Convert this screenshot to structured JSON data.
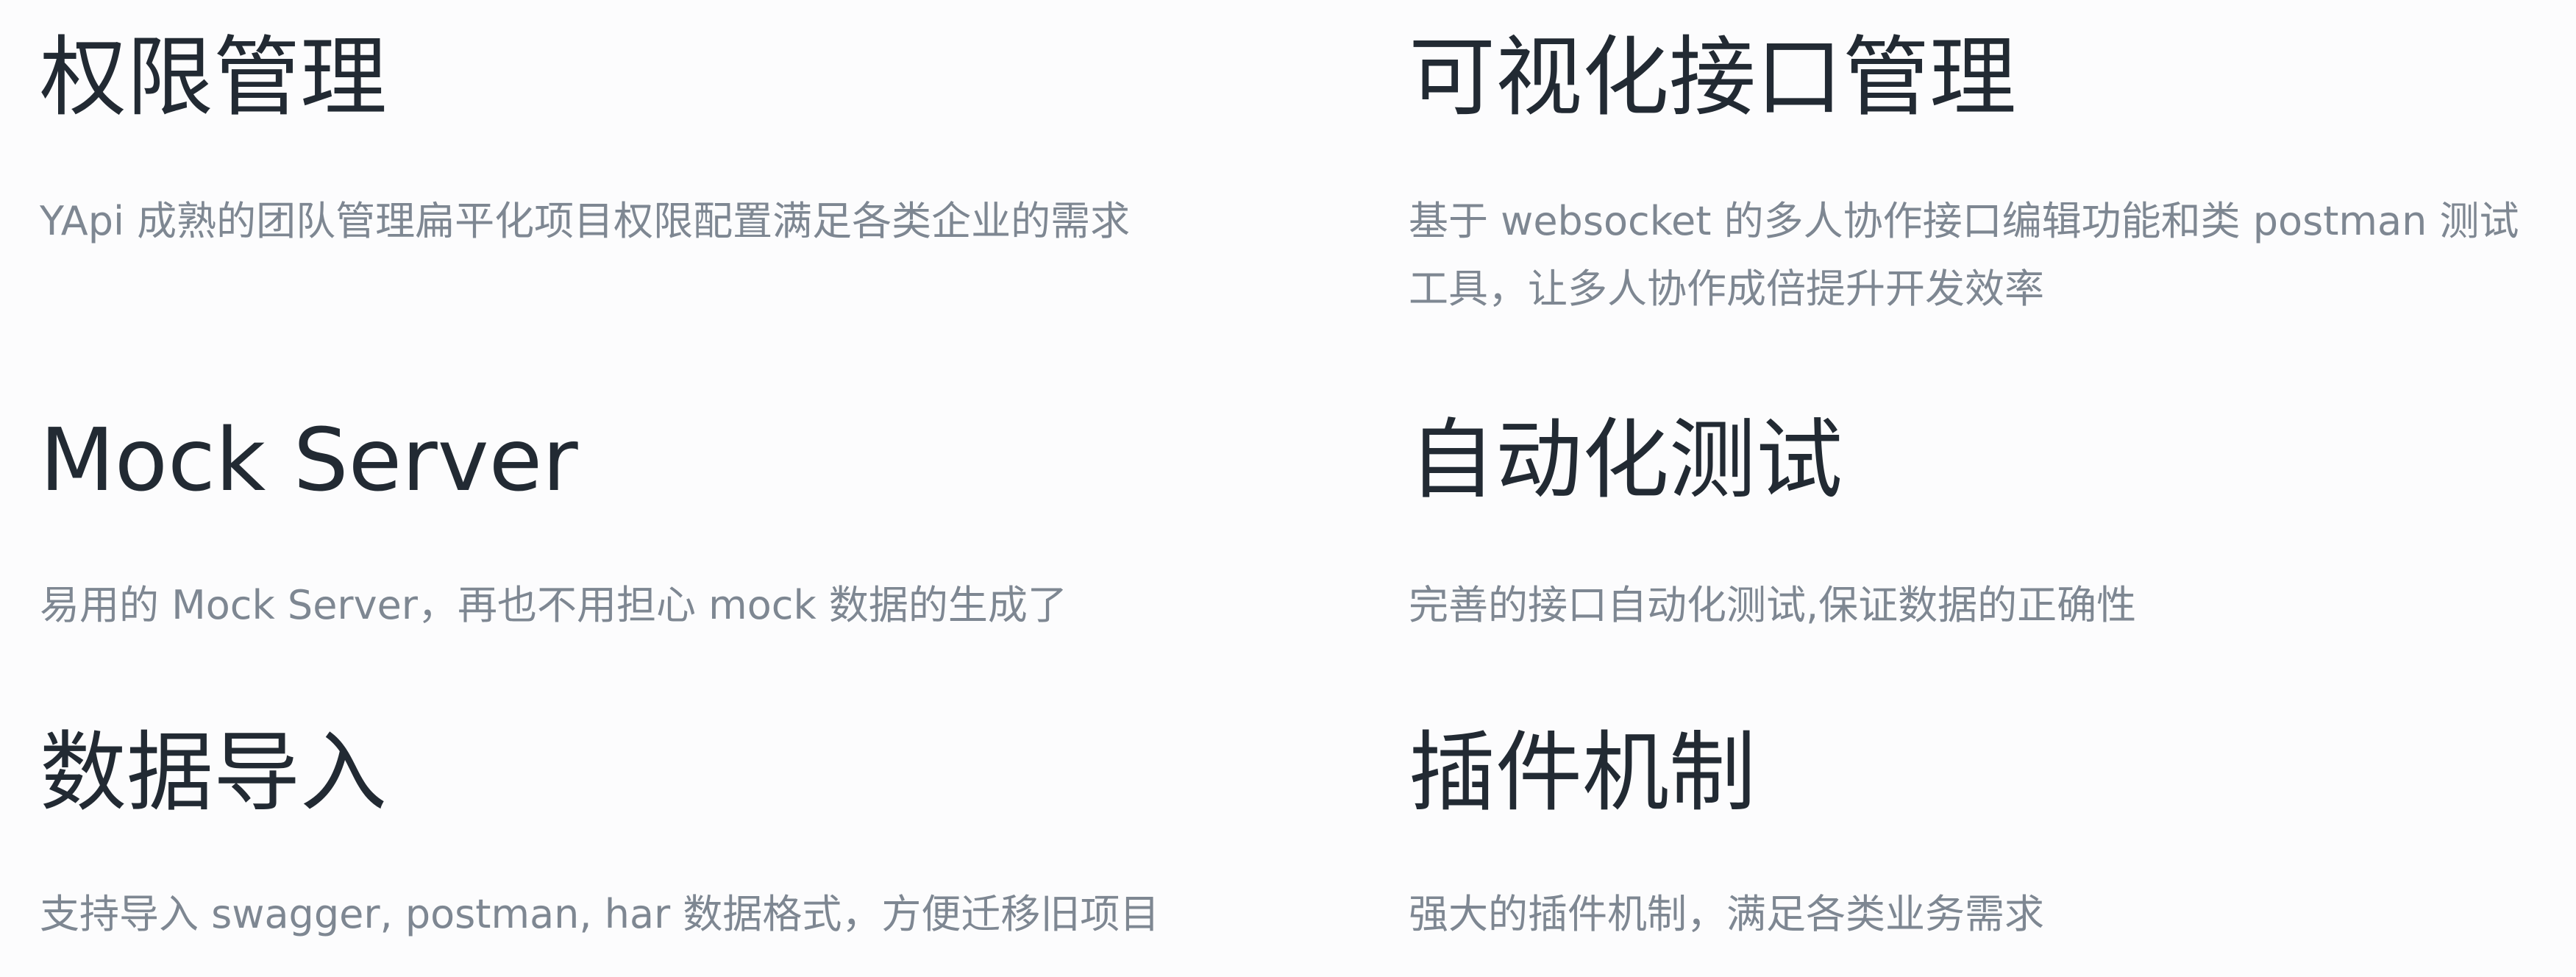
{
  "features": {
    "permission": {
      "title": "权限管理",
      "description": "YApi 成熟的团队管理扁平化项目权限配置满足各类企业的需求"
    },
    "api_visual": {
      "title": "可视化接口管理",
      "description": "基于 websocket 的多人协作接口编辑功能和类 postman 测试工具，让多人协作成倍提升开发效率"
    },
    "mock_server": {
      "title": "Mock Server",
      "description": "易用的 Mock Server，再也不用担心 mock 数据的生成了"
    },
    "auto_test": {
      "title": "自动化测试",
      "description": "完善的接口自动化测试,保证数据的正确性"
    },
    "data_import": {
      "title": "数据导入",
      "description": "支持导入 swagger, postman, har 数据格式，方便迁移旧项目"
    },
    "plugin": {
      "title": "插件机制",
      "description": "强大的插件机制，满足各类业务需求"
    }
  }
}
